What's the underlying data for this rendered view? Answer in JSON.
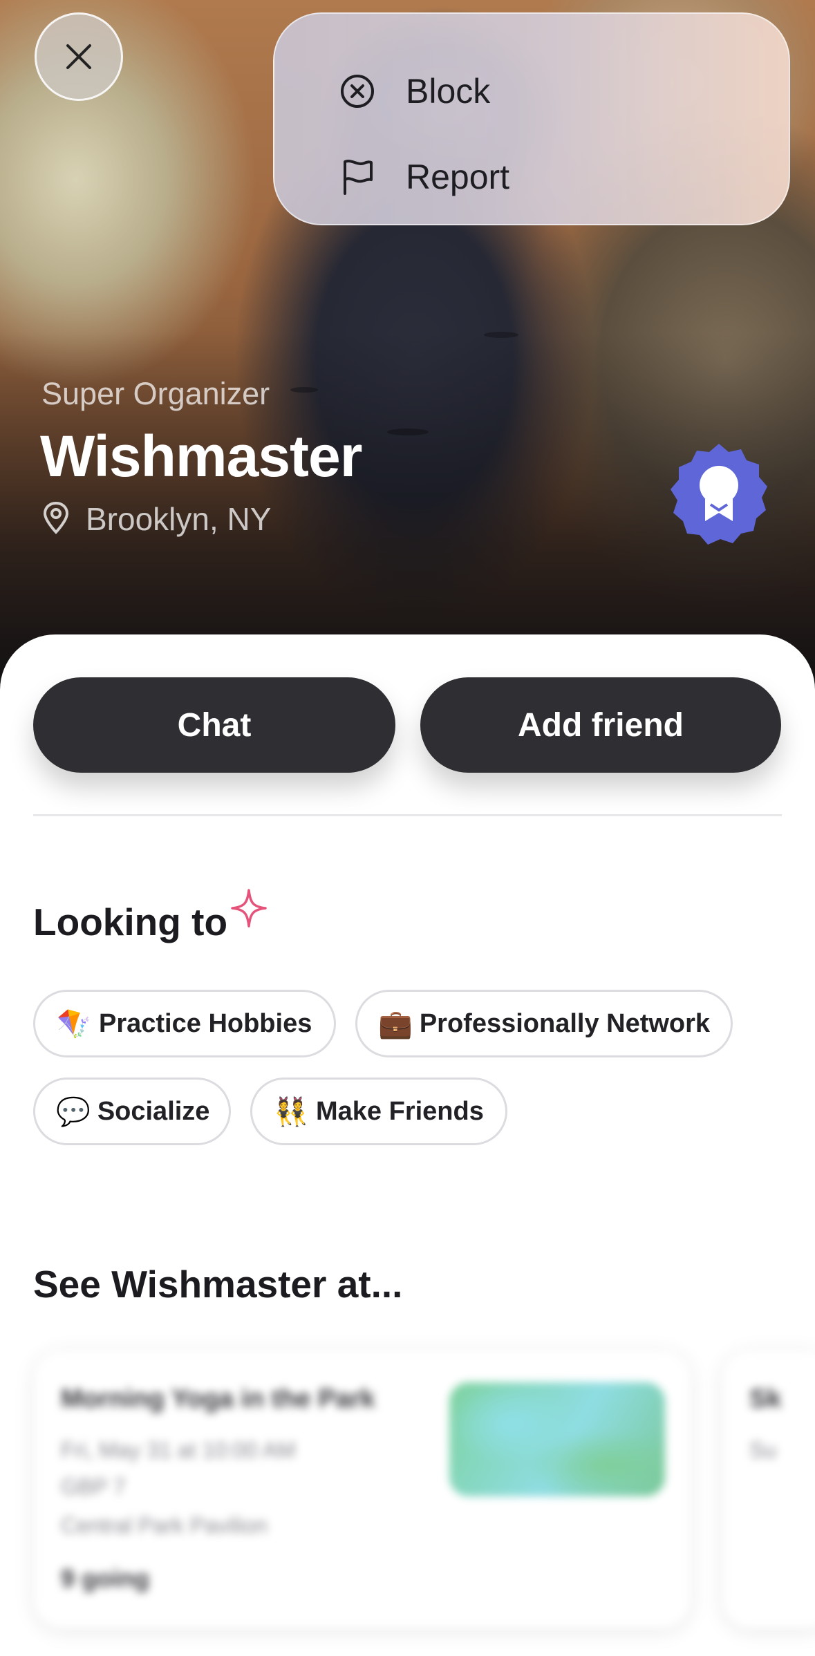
{
  "hero": {
    "subtitle": "Super Organizer",
    "name": "Wishmaster",
    "location": "Brooklyn, NY"
  },
  "menu": {
    "items": [
      {
        "label": "Block",
        "icon": "circle-x-icon"
      },
      {
        "label": "Report",
        "icon": "flag-icon"
      }
    ]
  },
  "actions": {
    "chat_label": "Chat",
    "add_friend_label": "Add friend"
  },
  "looking_to": {
    "title": "Looking to",
    "chips": [
      {
        "emoji": "🪁",
        "label": "Practice Hobbies"
      },
      {
        "emoji": "💼",
        "label": "Professionally Network"
      },
      {
        "emoji": "💬",
        "label": "Socialize"
      },
      {
        "emoji": "👯",
        "label": "Make Friends"
      }
    ]
  },
  "events": {
    "title": "See Wishmaster at...",
    "cards": [
      {
        "title": "Morning Yoga in the Park",
        "date": "Fri, May 31 at 10:00 AM",
        "price": "GBP 7",
        "venue": "Central Park Pavilion",
        "going": "9 going"
      },
      {
        "title": "Sk",
        "date": "Su",
        "price": "",
        "venue": "",
        "going": ""
      }
    ]
  },
  "colors": {
    "button": "#2f2f33",
    "badge": "#5f66d8",
    "sparkle": "#e5537a"
  }
}
